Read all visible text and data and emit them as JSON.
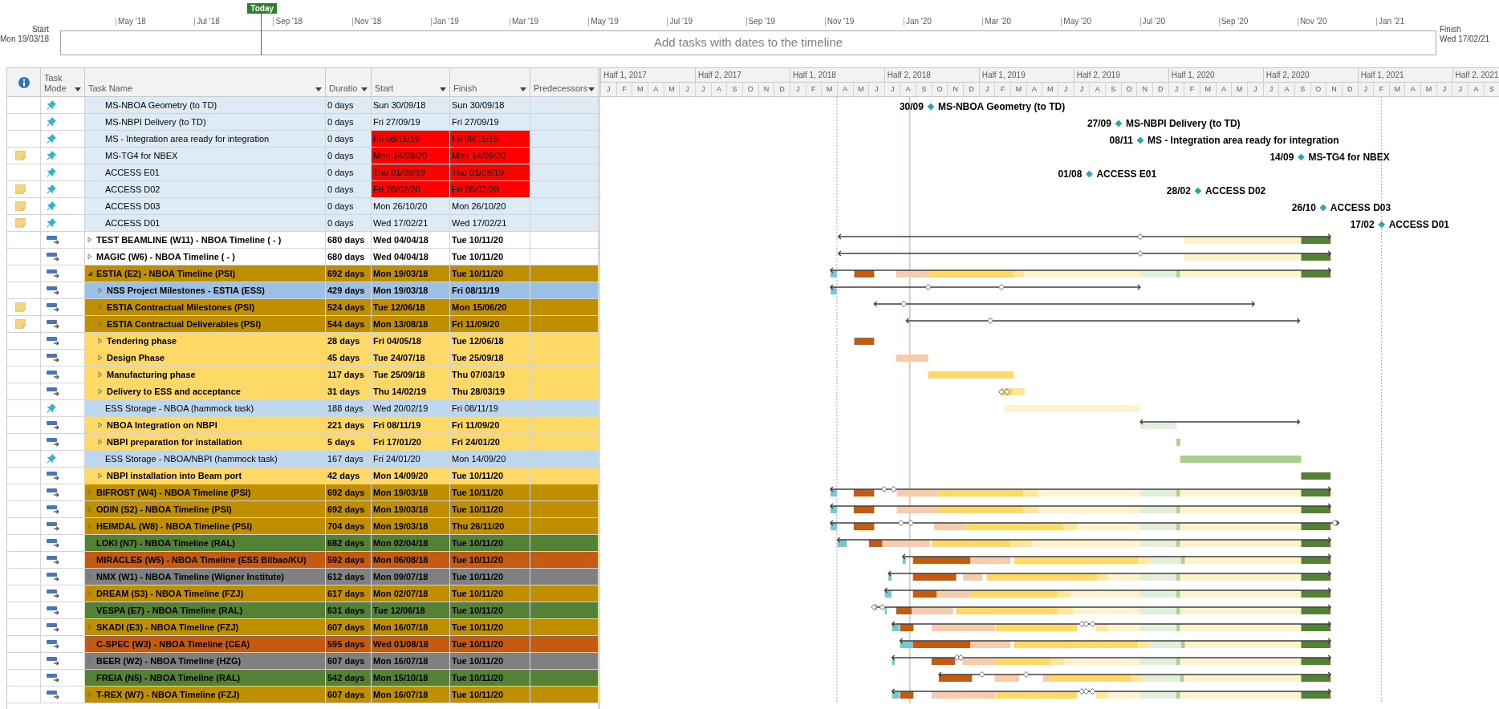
{
  "timeline": {
    "today_label": "Today",
    "start_label": "Start",
    "start_date": "Mon 19/03/18",
    "finish_label": "Finish",
    "finish_date": "Wed 17/02/21",
    "placeholder": "Add tasks with dates to the timeline",
    "ticks": [
      "May '18",
      "Jul '18",
      "Sep '18",
      "Nov '18",
      "Jan '19",
      "Mar '19",
      "May '19",
      "Jul '19",
      "Sep '19",
      "Nov '19",
      "Jan '20",
      "Mar '20",
      "May '20",
      "Jul '20",
      "Sep '20",
      "Nov '20",
      "Jan '21"
    ]
  },
  "table": {
    "columns": [
      {
        "label": "Task Mode"
      },
      {
        "label": "Task Name"
      },
      {
        "label": "Duratio"
      },
      {
        "label": "Start"
      },
      {
        "label": "Finish"
      },
      {
        "label": "Predecessors"
      }
    ],
    "rows": [
      {
        "kind": "manual",
        "note": false,
        "name": "MS-NBOA Geometry (to TD)",
        "duration": "0 days",
        "start": "Sun 30/09/18",
        "finish": "Sun 30/09/18",
        "late": false,
        "color": "#ddebf7",
        "milestone": {
          "date_label": "30/09",
          "label": "MS-NBOA Geometry (to TD)"
        }
      },
      {
        "kind": "manual",
        "note": false,
        "name": "MS-NBPI Delivery (to TD)",
        "duration": "0 days",
        "start": "Fri 27/09/19",
        "finish": "Fri 27/09/19",
        "late": false,
        "color": "#ddebf7",
        "milestone": {
          "date_label": "27/09",
          "label": "MS-NBPI Delivery (to TD)"
        }
      },
      {
        "kind": "manual",
        "note": false,
        "name": "MS - Integration area ready for integration",
        "duration": "0 days",
        "start": "Fri 08/11/19",
        "finish": "Fri 08/11/19",
        "late": true,
        "color": "#ddebf7",
        "milestone": {
          "date_label": "08/11",
          "label": "MS - Integration area ready for integration"
        }
      },
      {
        "kind": "manual",
        "note": true,
        "name": "MS-TG4 for NBEX",
        "duration": "0 days",
        "start": "Mon 14/09/20",
        "finish": "Mon 14/09/20",
        "late": true,
        "color": "#ddebf7",
        "milestone": {
          "date_label": "14/09",
          "label": "MS-TG4 for NBEX"
        }
      },
      {
        "kind": "manual",
        "note": false,
        "name": "ACCESS E01",
        "duration": "0 days",
        "start": "Thu 01/08/19",
        "finish": "Thu 01/08/19",
        "late": true,
        "color": "#ddebf7",
        "milestone": {
          "date_label": "01/08",
          "label": "ACCESS E01"
        }
      },
      {
        "kind": "manual",
        "note": true,
        "name": "ACCESS D02",
        "duration": "0 days",
        "start": "Fri 28/02/20",
        "finish": "Fri 28/02/20",
        "late": true,
        "color": "#ddebf7",
        "milestone": {
          "date_label": "28/02",
          "label": "ACCESS D02"
        }
      },
      {
        "kind": "manual",
        "note": true,
        "name": "ACCESS D03",
        "duration": "0 days",
        "start": "Mon 26/10/20",
        "finish": "Mon 26/10/20",
        "late": false,
        "color": "#ddebf7",
        "milestone": {
          "date_label": "26/10",
          "label": "ACCESS D03"
        }
      },
      {
        "kind": "manual",
        "note": true,
        "name": "ACCESS D01",
        "duration": "0 days",
        "start": "Wed 17/02/21",
        "finish": "Wed 17/02/21",
        "late": false,
        "color": "#ddebf7",
        "milestone": {
          "date_label": "17/02",
          "label": "ACCESS D01"
        }
      },
      {
        "kind": "auto",
        "note": false,
        "expanded": false,
        "name": "TEST BEAMLINE (W11) - NBOA Timeline ( - )",
        "duration": "680 days",
        "start": "Wed 04/04/18",
        "finish": "Tue 10/11/20",
        "late": false,
        "color": "#ffffff"
      },
      {
        "kind": "auto",
        "note": false,
        "expanded": false,
        "name": "MAGIC (W6) - NBOA Timeline ( - )",
        "duration": "680 days",
        "start": "Wed 04/04/18",
        "finish": "Tue 10/11/20",
        "late": false,
        "color": "#ffffff"
      },
      {
        "kind": "auto",
        "note": false,
        "expanded": true,
        "name": "ESTIA (E2) - NBOA Timeline (PSI)",
        "duration": "692 days",
        "start": "Mon 19/03/18",
        "finish": "Tue 10/11/20",
        "late": false,
        "color": "#bf8f00",
        "children": [
          {
            "kind": "auto",
            "note": false,
            "expanded": false,
            "name": "NSS Project Milestones - ESTIA (ESS)",
            "duration": "429 days",
            "start": "Mon 19/03/18",
            "finish": "Fri 08/11/19",
            "late": false,
            "color": "#9bc2e6"
          },
          {
            "kind": "auto",
            "note": true,
            "expanded": false,
            "name": "ESTIA Contractual Milestones (PSI)",
            "duration": "524 days",
            "start": "Tue 12/06/18",
            "finish": "Mon 15/06/20",
            "late": false,
            "color": "#bf8f00"
          },
          {
            "kind": "auto",
            "note": true,
            "expanded": false,
            "name": "ESTIA Contractual Deliverables (PSI)",
            "duration": "544 days",
            "start": "Mon 13/08/18",
            "finish": "Fri 11/09/20",
            "late": false,
            "color": "#bf8f00"
          },
          {
            "kind": "auto",
            "note": false,
            "expanded": false,
            "name": "Tendering phase",
            "duration": "28 days",
            "start": "Fri 04/05/18",
            "finish": "Tue 12/06/18",
            "late": false,
            "color": "#ffd966"
          },
          {
            "kind": "auto",
            "note": false,
            "expanded": false,
            "name": "Design Phase",
            "duration": "45 days",
            "start": "Tue 24/07/18",
            "finish": "Tue 25/09/18",
            "late": false,
            "color": "#ffd966"
          },
          {
            "kind": "auto",
            "note": false,
            "expanded": false,
            "name": "Manufacturing phase",
            "duration": "117 days",
            "start": "Tue 25/09/18",
            "finish": "Thu 07/03/19",
            "late": false,
            "color": "#ffd966"
          },
          {
            "kind": "auto",
            "note": false,
            "expanded": false,
            "name": "Delivery to ESS and acceptance",
            "duration": "31 days",
            "start": "Thu 14/02/19",
            "finish": "Thu 28/03/19",
            "late": false,
            "color": "#ffd966"
          },
          {
            "kind": "manual",
            "note": false,
            "name": "ESS Storage - NBOA (hammock task)",
            "duration": "188 days",
            "start": "Wed 20/02/19",
            "finish": "Fri 08/11/19",
            "late": false,
            "color": "#bdd7ee"
          },
          {
            "kind": "auto",
            "note": false,
            "expanded": false,
            "name": "NBOA Integration on NBPI",
            "duration": "221 days",
            "start": "Fri 08/11/19",
            "finish": "Fri 11/09/20",
            "late": false,
            "color": "#ffd966"
          },
          {
            "kind": "auto",
            "note": false,
            "expanded": false,
            "name": "NBPI preparation for installation",
            "duration": "5 days",
            "start": "Fri 17/01/20",
            "finish": "Fri 24/01/20",
            "late": false,
            "color": "#ffd966"
          },
          {
            "kind": "manual",
            "note": false,
            "name": "ESS Storage - NBOA/NBPI (hammock task)",
            "duration": "167 days",
            "start": "Fri 24/01/20",
            "finish": "Mon 14/09/20",
            "late": false,
            "color": "#bdd7ee"
          },
          {
            "kind": "auto",
            "note": false,
            "expanded": false,
            "name": "NBPI installation into Beam port",
            "duration": "42 days",
            "start": "Mon 14/09/20",
            "finish": "Tue 10/11/20",
            "late": false,
            "color": "#ffd966"
          }
        ]
      },
      {
        "kind": "auto",
        "note": false,
        "expanded": false,
        "name": "BIFROST (W4) - NBOA Timeline (PSI)",
        "duration": "692 days",
        "start": "Mon 19/03/18",
        "finish": "Tue 10/11/20",
        "late": false,
        "color": "#bf8f00"
      },
      {
        "kind": "auto",
        "note": false,
        "expanded": false,
        "name": "ODIN (S2) - NBOA Timeline (PSI)",
        "duration": "692 days",
        "start": "Mon 19/03/18",
        "finish": "Tue 10/11/20",
        "late": false,
        "color": "#bf8f00"
      },
      {
        "kind": "auto",
        "note": false,
        "expanded": false,
        "name": "HEIMDAL (W8) - NBOA Timeline (PSI)",
        "duration": "704 days",
        "start": "Mon 19/03/18",
        "finish": "Thu 26/11/20",
        "late": false,
        "color": "#bf8f00"
      },
      {
        "kind": "auto",
        "note": false,
        "expanded": false,
        "name": "LOKI (N7) - NBOA Timeline (RAL)",
        "duration": "682 days",
        "start": "Mon 02/04/18",
        "finish": "Tue 10/11/20",
        "late": false,
        "color": "#548235"
      },
      {
        "kind": "auto",
        "note": false,
        "expanded": false,
        "name": "MIRACLES (W5) - NBOA Timeline (ESS Bilbao/KU)",
        "duration": "592 days",
        "start": "Mon 06/08/18",
        "finish": "Tue 10/11/20",
        "late": false,
        "color": "#c55a11"
      },
      {
        "kind": "auto",
        "note": false,
        "expanded": false,
        "name": "NMX (W1) - NBOA Timeline (Wigner Institute)",
        "duration": "612 days",
        "start": "Mon 09/07/18",
        "finish": "Tue 10/11/20",
        "late": false,
        "color": "#808080"
      },
      {
        "kind": "auto",
        "note": false,
        "expanded": false,
        "name": "DREAM (S3) - NBOA Timeline (FZJ)",
        "duration": "617 days",
        "start": "Mon 02/07/18",
        "finish": "Tue 10/11/20",
        "late": false,
        "color": "#bf8f00"
      },
      {
        "kind": "auto",
        "note": false,
        "expanded": false,
        "name": "VESPA (E7) - NBOA Timeline (RAL)",
        "duration": "631 days",
        "start": "Tue 12/06/18",
        "finish": "Tue 10/11/20",
        "late": false,
        "color": "#548235"
      },
      {
        "kind": "auto",
        "note": false,
        "expanded": false,
        "name": "SKADI (E3) - NBOA Timeline (FZJ)",
        "duration": "607 days",
        "start": "Mon 16/07/18",
        "finish": "Tue 10/11/20",
        "late": false,
        "color": "#bf8f00"
      },
      {
        "kind": "auto",
        "note": false,
        "expanded": false,
        "name": "C-SPEC (W3) - NBOA Timeline (CEA)",
        "duration": "595 days",
        "start": "Wed 01/08/18",
        "finish": "Tue 10/11/20",
        "late": false,
        "color": "#c55a11"
      },
      {
        "kind": "auto",
        "note": false,
        "expanded": false,
        "name": "BEER (W2) - NBOA Timeline (HZG)",
        "duration": "607 days",
        "start": "Mon 16/07/18",
        "finish": "Tue 10/11/20",
        "late": false,
        "color": "#808080"
      },
      {
        "kind": "auto",
        "note": false,
        "expanded": false,
        "name": "FREIA (N5) - NBOA Timeline (RAL)",
        "duration": "542 days",
        "start": "Mon 15/10/18",
        "finish": "Tue 10/11/20",
        "late": false,
        "color": "#548235"
      },
      {
        "kind": "auto",
        "note": false,
        "expanded": false,
        "name": "T-REX (W7) - NBOA Timeline (FZJ)",
        "duration": "607 days",
        "start": "Mon 16/07/18",
        "finish": "Tue 10/11/20",
        "late": false,
        "color": "#bf8f00"
      }
    ]
  },
  "gantt": {
    "halves": [
      "Half 1, 2017",
      "Half 2, 2017",
      "Half 1, 2018",
      "Half 2, 2018",
      "Half 1, 2019",
      "Half 2, 2019",
      "Half 1, 2020",
      "Half 2, 2020",
      "Half 1, 2021",
      "Half 2, 2021"
    ],
    "months": [
      "J",
      "F",
      "M",
      "A",
      "M",
      "J",
      "J",
      "A",
      "S",
      "O",
      "N",
      "D",
      "J",
      "F",
      "M",
      "A",
      "M",
      "J",
      "J",
      "A",
      "S",
      "O",
      "N",
      "D",
      "J",
      "F",
      "M",
      "A",
      "M",
      "J",
      "J",
      "A",
      "S",
      "O",
      "N",
      "D",
      "J",
      "F",
      "M",
      "A",
      "M",
      "J",
      "J",
      "A",
      "S",
      "O",
      "N",
      "D",
      "J",
      "F",
      "M",
      "A",
      "M",
      "J",
      "J",
      "A",
      "S"
    ]
  }
}
